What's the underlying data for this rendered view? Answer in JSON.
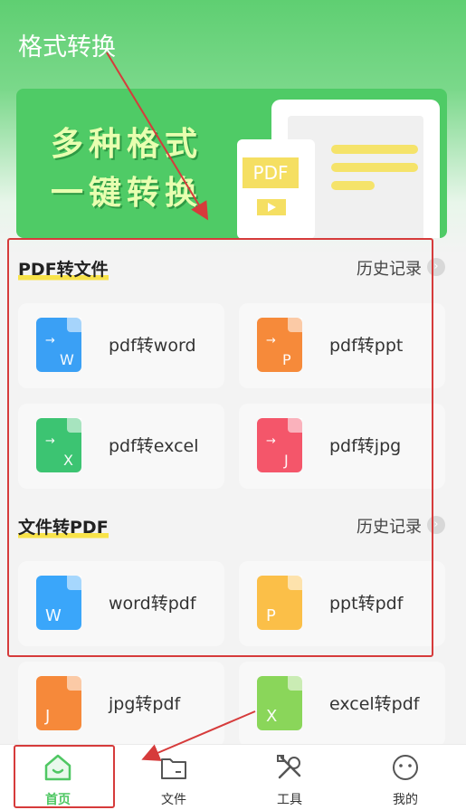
{
  "header": {
    "title": "格式转换"
  },
  "banner": {
    "line1": "多种格式",
    "line2": "一键转换",
    "doc_label": "PDF"
  },
  "section_pdf_to_file": {
    "title": "PDF转文件",
    "history": "历史记录",
    "items": [
      {
        "label": "pdf转word",
        "icon": "word-file-icon",
        "glyph": "W",
        "color": "#3aa0f5"
      },
      {
        "label": "pdf转ppt",
        "icon": "ppt-file-icon",
        "glyph": "P",
        "color": "#f68a3a"
      },
      {
        "label": "pdf转excel",
        "icon": "excel-file-icon",
        "glyph": "X",
        "color": "#3cc472"
      },
      {
        "label": "pdf转jpg",
        "icon": "jpg-file-icon",
        "glyph": "J",
        "color": "#f4566a"
      }
    ]
  },
  "section_file_to_pdf": {
    "title": "文件转PDF",
    "history": "历史记录",
    "items": [
      {
        "label": "word转pdf",
        "icon": "word-file-icon",
        "glyph": "W",
        "color": "#3aa6fa"
      },
      {
        "label": "ppt转pdf",
        "icon": "ppt-file-icon",
        "glyph": "P",
        "color": "#fbbf48"
      },
      {
        "label": "jpg转pdf",
        "icon": "jpg-file-icon",
        "glyph": "J",
        "color": "#f6893a"
      },
      {
        "label": "excel转pdf",
        "icon": "excel-file-icon",
        "glyph": "X",
        "color": "#8ad65a"
      }
    ]
  },
  "tabbar": {
    "items": [
      {
        "label": "首页",
        "icon": "home-icon",
        "active": true
      },
      {
        "label": "文件",
        "icon": "folder-icon",
        "active": false
      },
      {
        "label": "工具",
        "icon": "tools-icon",
        "active": false
      },
      {
        "label": "我的",
        "icon": "profile-icon",
        "active": false
      }
    ]
  },
  "colors": {
    "accent": "#4fc763",
    "annotation_red": "#d63b3b",
    "highlight_yellow": "#f8e34a"
  }
}
